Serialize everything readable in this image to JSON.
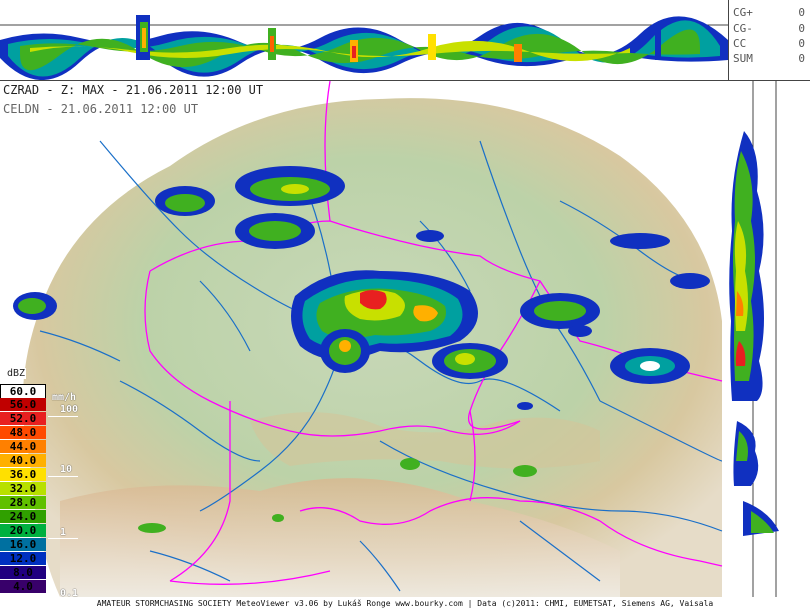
{
  "header": {
    "title": "CZRAD - Z: MAX - 21.06.2011 12:00 UT",
    "subtitle": "CELDN - 21.06.2011 12:00 UT"
  },
  "lightning": {
    "rows": [
      {
        "label": "CG+",
        "value": "0"
      },
      {
        "label": "CG-",
        "value": "0"
      },
      {
        "label": "CC",
        "value": "0"
      },
      {
        "label": "SUM",
        "value": "0"
      }
    ]
  },
  "legend": {
    "title": "dBZ",
    "levels": [
      {
        "value": "60.0",
        "color": "#ffffff"
      },
      {
        "value": "56.0",
        "color": "#c00000"
      },
      {
        "value": "52.0",
        "color": "#e82020"
      },
      {
        "value": "48.0",
        "color": "#ff4a00"
      },
      {
        "value": "44.0",
        "color": "#ff8000"
      },
      {
        "value": "40.0",
        "color": "#ffb000"
      },
      {
        "value": "36.0",
        "color": "#ffe000"
      },
      {
        "value": "32.0",
        "color": "#b8e000"
      },
      {
        "value": "28.0",
        "color": "#60c000"
      },
      {
        "value": "24.0",
        "color": "#30a000"
      },
      {
        "value": "20.0",
        "color": "#00b040"
      },
      {
        "value": "16.0",
        "color": "#0070a0"
      },
      {
        "value": "12.0",
        "color": "#0030c0"
      },
      {
        "value": "8.0",
        "color": "#200080"
      },
      {
        "value": "4.0",
        "color": "#38006a"
      }
    ],
    "rate_unit": "mm/h",
    "rate_labels": [
      "100",
      "10",
      "1",
      "0.1"
    ]
  },
  "footer": {
    "text": "AMATEUR STORMCHASING SOCIETY MeteoViewer v3.06 by Lukáš Ronge www.bourky.com | Data (c)2011: CHMI, EUMETSAT, Siemens AG, Vaisala"
  },
  "colors": {
    "border": "#ff00ff",
    "river": "#1a6fc8",
    "land_low": "#c8d8b8",
    "land_high": "#d8b890"
  }
}
